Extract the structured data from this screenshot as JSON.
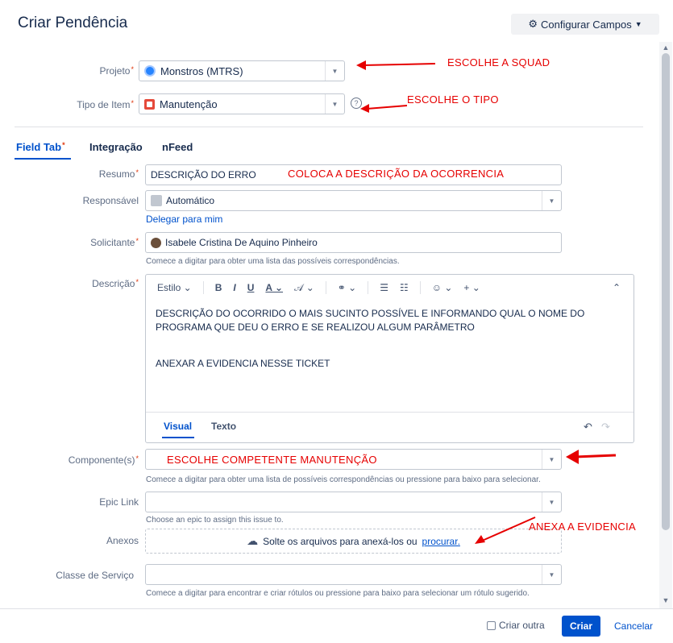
{
  "dialog": {
    "title": "Criar Pendência",
    "configure_fields": "Configurar Campos"
  },
  "fields": {
    "project": {
      "label": "Projeto",
      "value": "Monstros (MTRS)"
    },
    "issue_type": {
      "label": "Tipo de Item",
      "value": "Manutenção"
    }
  },
  "tabs": [
    {
      "label": "Field Tab"
    },
    {
      "label": "Integração"
    },
    {
      "label": "nFeed"
    }
  ],
  "form": {
    "summary": {
      "label": "Resumo",
      "value": "DESCRIÇÃO DO ERRO"
    },
    "assignee": {
      "label": "Responsável",
      "value": "Automático",
      "link": "Delegar para mim"
    },
    "reporter": {
      "label": "Solicitante",
      "value": "Isabele Cristina De Aquino Pinheiro",
      "hint": "Comece a digitar para obter uma lista das possíveis correspondências."
    },
    "description": {
      "label": "Descrição",
      "toolbar": {
        "style": "Estilo"
      },
      "body_line1": "DESCRIÇÃO DO OCORRIDO O MAIS SUCINTO POSSÍVEL E INFORMANDO QUAL O NOME DO PROGRAMA QUE DEU O ERRO E SE REALIZOU ALGUM PARÂMETRO",
      "body_line2": "ANEXAR A EVIDENCIA NESSE TICKET",
      "tab_visual": "Visual",
      "tab_text": "Texto"
    },
    "components": {
      "label": "Componente(s)",
      "hint": "Comece a digitar para obter uma lista de possíveis correspondências ou pressione para baixo para selecionar."
    },
    "epic_link": {
      "label": "Epic Link",
      "hint": "Choose an epic to assign this issue to."
    },
    "attachments": {
      "label": "Anexos",
      "drop_text": "Solte os arquivos para anexá-los ou",
      "browse": "procurar."
    },
    "service_class": {
      "label": "Classe de Serviço",
      "hint": "Comece a digitar para encontrar e criar rótulos ou pressione para baixo para selecionar um rótulo sugerido."
    }
  },
  "annotations": {
    "squad": "ESCOLHE A SQUAD",
    "type": "ESCOLHE O TIPO",
    "description": "COLOCA A DESCRIÇÃO DA OCORRENCIA",
    "component": "ESCOLHE COMPETENTE MANUTENÇÃO",
    "attachment": "ANEXA A EVIDENCIA"
  },
  "footer": {
    "create_another": "Criar outra",
    "create": "Criar",
    "cancel": "Cancelar"
  },
  "colors": {
    "accent": "#0052cc",
    "annotation": "#e60000",
    "required": "#de350b"
  }
}
